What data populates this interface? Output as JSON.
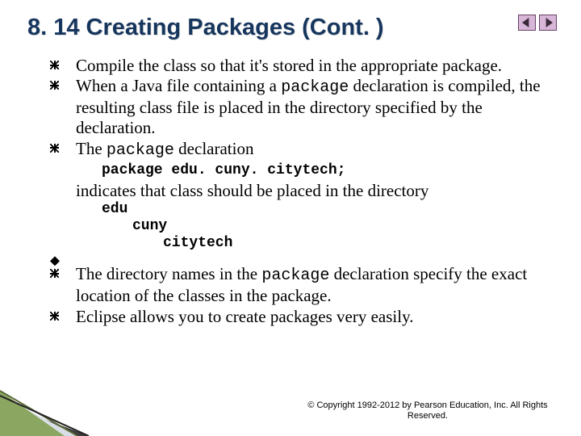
{
  "title": "8. 14  Creating Packages (Cont. )",
  "nav": {
    "prev": "previous slide",
    "next": "next slide"
  },
  "bullets": {
    "b1": "Compile the class so that it's stored in the appropriate package.",
    "b2a": "When a Java file containing a ",
    "b2b": "package",
    "b2c": " declaration is compiled, the resulting class file is placed in the directory specified by the declaration.",
    "b3a": "The ",
    "b3b": "package",
    "b3c": " declaration",
    "code1": "package edu. cuny. citytech;",
    "b3d": "indicates that class should be placed in the directory",
    "dir1": "edu",
    "dir2": "cuny",
    "dir3": "citytech",
    "b4a": "The directory names in the ",
    "b4b": "package",
    "b4c": " declaration specify the exact location of the classes in the package.",
    "b5": "Eclipse allows you to create packages very easily."
  },
  "copyright": "© Copyright 1992-2012 by Pearson Education, Inc. All Rights Reserved."
}
